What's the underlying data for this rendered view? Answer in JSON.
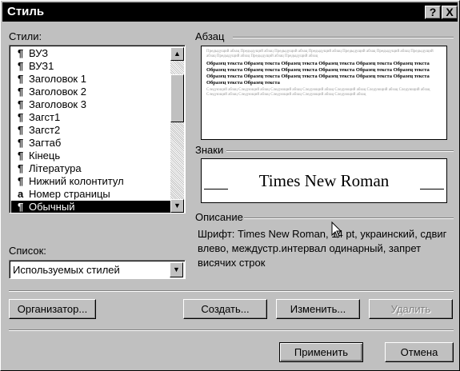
{
  "window": {
    "title": "Стиль",
    "help_label": "?",
    "close_label": "X"
  },
  "styles_label": "Стили:",
  "styles": [
    {
      "glyph": "¶",
      "name": "ВУЗ"
    },
    {
      "glyph": "¶",
      "name": "ВУЗ1"
    },
    {
      "glyph": "¶",
      "name": "Заголовок 1"
    },
    {
      "glyph": "¶",
      "name": "Заголовок 2"
    },
    {
      "glyph": "¶",
      "name": "Заголовок 3"
    },
    {
      "glyph": "¶",
      "name": "Загст1"
    },
    {
      "glyph": "¶",
      "name": "Загст2"
    },
    {
      "glyph": "¶",
      "name": "Загтаб"
    },
    {
      "glyph": "¶",
      "name": "Кінець"
    },
    {
      "glyph": "¶",
      "name": "Література"
    },
    {
      "glyph": "¶",
      "name": "Нижний колонтитул"
    },
    {
      "glyph": "a",
      "name": "Номер страницы"
    },
    {
      "glyph": "¶",
      "name": "Обычный"
    }
  ],
  "selected_style": "Обычный",
  "paragraph_label": "Абзац",
  "paragraph_preview": {
    "gray_text": "Предыдущий абзац Предыдущий абзац Предыдущий абзац Предыдущий абзац Предыдущий абзац Предыдущий абзац Предыдущий абзац Предыдущий абзац Предыдущий абзац Предыдущий абзац",
    "sample_text": "Образец текста Образец текста Образец текста Образец текста Образец текста Образец текста Образец текста Образец текста Образец текста Образец текста Образец текста Образец текста Образец текста Образец текста Образец текста Образец текста Образец текста Образец текста Образец текста Образец текста",
    "gray_text_after": "Следующий абзац Следующий абзац Следующий абзац Следующий абзац Следующий абзац Следующий абзац Следующий абзац Следующий абзац Следующий абзац Следующий абзац Следующий абзац Следующий абзац"
  },
  "chars_label": "Знаки",
  "font_preview": "Times New Roman",
  "description_label": "Описание",
  "description": "Шрифт: Times New Roman, 14 pt, украинский, сдвиг влево, междустр.интервал одинарный, запрет висячих строк",
  "list_label": "Список:",
  "list_value": "Используемых стилей",
  "buttons": {
    "organizer": "Организатор...",
    "create": "Создать...",
    "modify": "Изменить...",
    "delete": "Удалить",
    "apply": "Применить",
    "cancel": "Отмена"
  }
}
